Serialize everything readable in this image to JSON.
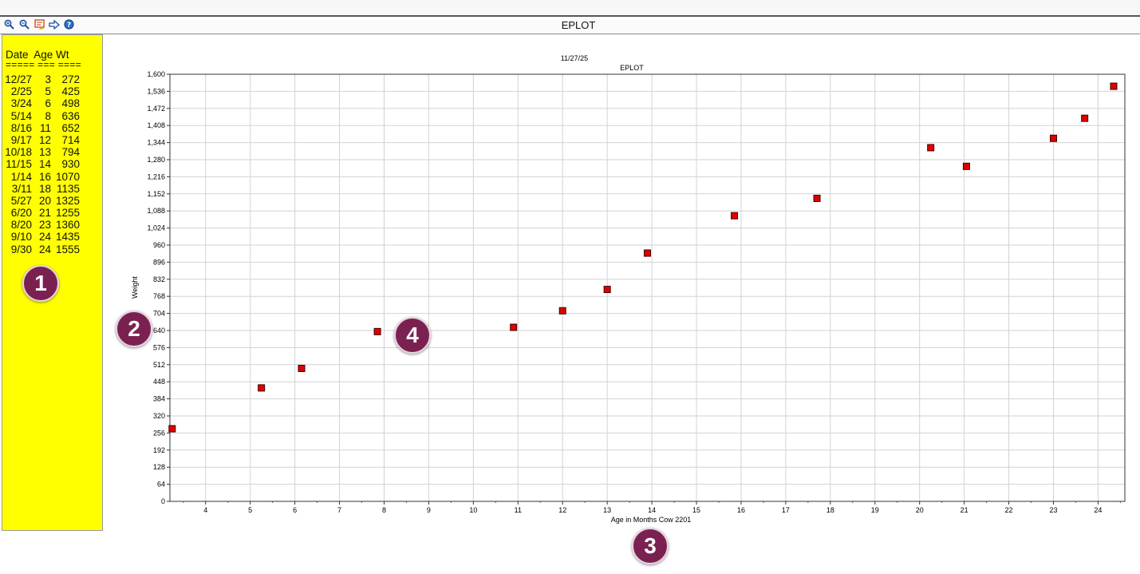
{
  "window": {
    "title": "EPLOT"
  },
  "toolbar": {
    "tools": [
      {
        "name": "zoom-in-icon",
        "glyph": "🔍"
      },
      {
        "name": "zoom-out-icon",
        "glyph": "🔍"
      },
      {
        "name": "properties-icon",
        "glyph": "✎"
      },
      {
        "name": "export-arrow-icon",
        "glyph": "⇨"
      },
      {
        "name": "help-icon",
        "glyph": "?"
      }
    ]
  },
  "table": {
    "header": "Date  Age Wt",
    "separator": "===== === ====",
    "rows": [
      {
        "date": "12/27",
        "age": "3",
        "wt": "272"
      },
      {
        "date": "2/25",
        "age": "5",
        "wt": "425"
      },
      {
        "date": "3/24",
        "age": "6",
        "wt": "498"
      },
      {
        "date": "5/14",
        "age": "8",
        "wt": "636"
      },
      {
        "date": "8/16",
        "age": "11",
        "wt": "652"
      },
      {
        "date": "9/17",
        "age": "12",
        "wt": "714"
      },
      {
        "date": "10/18",
        "age": "13",
        "wt": "794"
      },
      {
        "date": "11/15",
        "age": "14",
        "wt": "930"
      },
      {
        "date": "1/14",
        "age": "16",
        "wt": "1070"
      },
      {
        "date": "3/11",
        "age": "18",
        "wt": "1135"
      },
      {
        "date": "5/27",
        "age": "20",
        "wt": "1325"
      },
      {
        "date": "6/20",
        "age": "21",
        "wt": "1255"
      },
      {
        "date": "8/20",
        "age": "23",
        "wt": "1360"
      },
      {
        "date": "9/10",
        "age": "24",
        "wt": "1435"
      },
      {
        "date": "9/30",
        "age": "24",
        "wt": "1555"
      }
    ]
  },
  "markers": [
    "1",
    "2",
    "3",
    "4"
  ],
  "chart_data": {
    "type": "scatter",
    "title": "EPLOT",
    "subtitle": "11/27/25",
    "xlabel": "Age in Months Cow 2201",
    "ylabel": "Weight",
    "xlim": [
      3.2,
      24.6
    ],
    "ylim": [
      0,
      1600
    ],
    "xticks": [
      4,
      5,
      6,
      7,
      8,
      9,
      10,
      11,
      12,
      13,
      14,
      15,
      16,
      17,
      18,
      19,
      20,
      21,
      22,
      23,
      24
    ],
    "yticks": [
      0,
      64,
      128,
      192,
      256,
      320,
      384,
      448,
      512,
      576,
      640,
      704,
      768,
      832,
      896,
      960,
      1024,
      1088,
      1152,
      1216,
      1280,
      1344,
      1408,
      1472,
      1536,
      1600
    ],
    "ytick_labels": [
      "0",
      "64",
      "128",
      "192",
      "256",
      "320",
      "384",
      "448",
      "512",
      "576",
      "640",
      "704",
      "768",
      "832",
      "896",
      "960",
      "1,024",
      "1,088",
      "1,152",
      "1,216",
      "1,280",
      "1,344",
      "1,408",
      "1,472",
      "1,536",
      "1,600"
    ],
    "grid": true,
    "marker_color": "#dd0000",
    "points": [
      {
        "x": 3.25,
        "y": 272
      },
      {
        "x": 5.25,
        "y": 425
      },
      {
        "x": 6.15,
        "y": 498
      },
      {
        "x": 7.85,
        "y": 636
      },
      {
        "x": 10.9,
        "y": 652
      },
      {
        "x": 12.0,
        "y": 714
      },
      {
        "x": 13.0,
        "y": 794
      },
      {
        "x": 13.9,
        "y": 930
      },
      {
        "x": 15.85,
        "y": 1070
      },
      {
        "x": 17.7,
        "y": 1135
      },
      {
        "x": 20.25,
        "y": 1325
      },
      {
        "x": 21.05,
        "y": 1255
      },
      {
        "x": 23.0,
        "y": 1360
      },
      {
        "x": 23.7,
        "y": 1435
      },
      {
        "x": 24.35,
        "y": 1555
      }
    ]
  }
}
